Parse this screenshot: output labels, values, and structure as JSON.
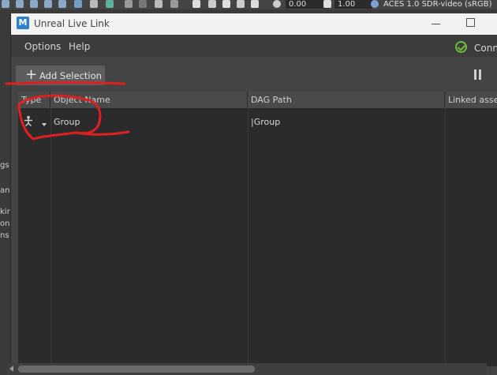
{
  "maya_toolbar": {
    "field_1": "0.00",
    "field_2": "1.00",
    "colorspace": "ACES 1.0 SDR-video (sRGB)"
  },
  "background_fragments": [
    "gs",
    "ano",
    "kin",
    "on",
    "ns"
  ],
  "window": {
    "app_icon_letter": "M",
    "title": "Unreal Live Link",
    "menu": [
      "Options",
      "Help"
    ],
    "connection_label": "Conn",
    "add_selection_label": "Add Selection"
  },
  "table": {
    "columns": [
      "Type",
      "Object Name",
      "DAG Path",
      "Linked asset"
    ],
    "rows": [
      {
        "type_icon": "joint-icon",
        "object_name": "Group",
        "dag_path": "|Group",
        "linked_asset": ""
      }
    ]
  },
  "colors": {
    "connected": "#6fbe3a",
    "annotation": "#e02020",
    "app_icon": "#2f7fd1"
  }
}
